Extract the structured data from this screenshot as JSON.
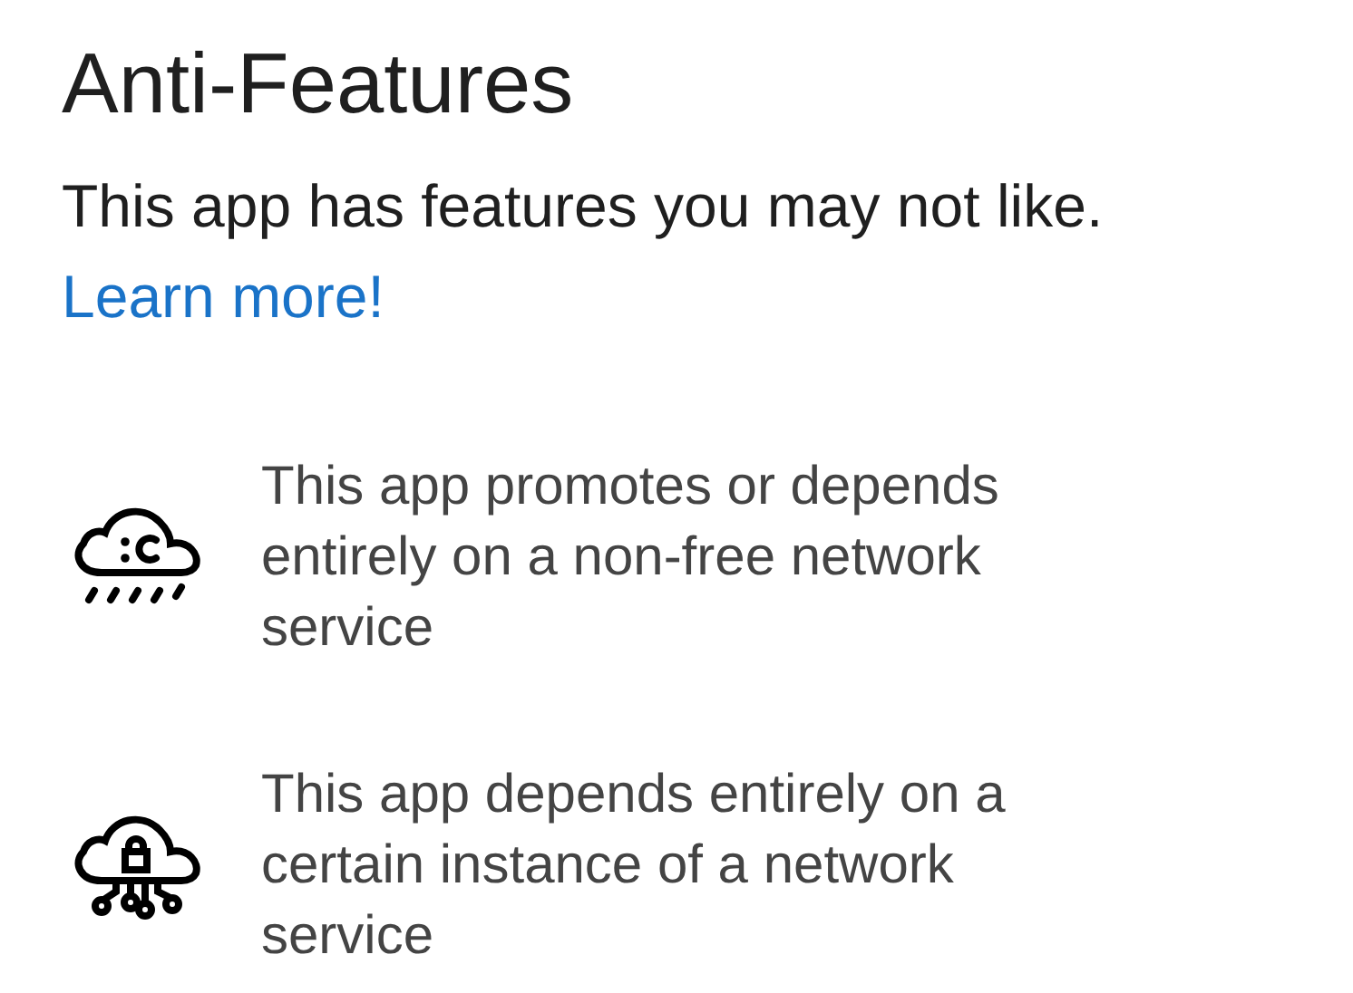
{
  "title": "Anti-Features",
  "intro": {
    "text": "This app has features you may not like.",
    "link": "Learn more!"
  },
  "features": [
    {
      "kind": "nonfree-net",
      "text": "This app promotes or depends entirely on a non-free network service"
    },
    {
      "kind": "tethered-net",
      "text": "This app depends entirely on a certain instance of a network service"
    }
  ]
}
